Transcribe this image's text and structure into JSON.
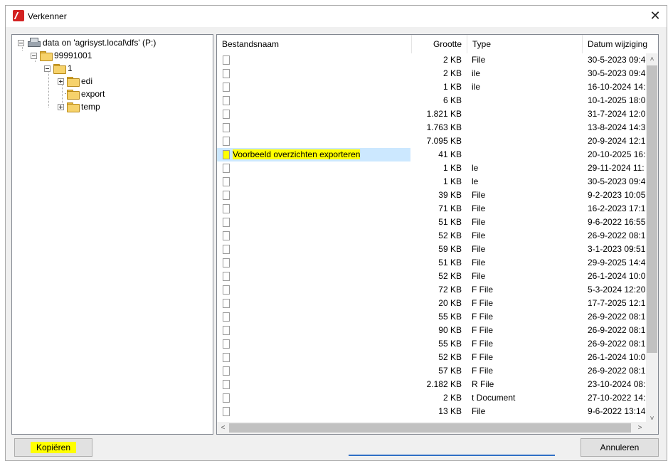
{
  "window": {
    "title": "Verkenner",
    "close_glyph": "✕"
  },
  "tree": {
    "drive_label": "data on 'agrisyst.local\\dfs' (P:)",
    "nodes": [
      {
        "label": "99991001"
      },
      {
        "label": "1"
      },
      {
        "label": "edi"
      },
      {
        "label": "export"
      },
      {
        "label": "temp"
      }
    ]
  },
  "list": {
    "columns": {
      "name": "Bestandsnaam",
      "size": "Grootte",
      "type": "Type",
      "date": "Datum wijziging"
    },
    "rows": [
      {
        "name": "",
        "size": "2 KB",
        "type": "File",
        "date": "30-5-2023 09:4"
      },
      {
        "name": "",
        "size": "2 KB",
        "type": "ile",
        "date": "30-5-2023 09:4"
      },
      {
        "name": "",
        "size": "1 KB",
        "type": "ile",
        "date": "16-10-2024 14:"
      },
      {
        "name": "",
        "size": "6 KB",
        "type": "",
        "date": "10-1-2025 18:0"
      },
      {
        "name": "",
        "size": "1.821 KB",
        "type": "",
        "date": "31-7-2024 12:0"
      },
      {
        "name": "",
        "size": "1.763 KB",
        "type": "",
        "date": "13-8-2024 14:3"
      },
      {
        "name": "",
        "size": "7.095 KB",
        "type": "",
        "date": "20-9-2024 12:1"
      },
      {
        "name": "Voorbeeld overzichten exporteren",
        "size": "41 KB",
        "type": "",
        "date": "20-10-2025 16:",
        "selected": true
      },
      {
        "name": "",
        "size": "1 KB",
        "type": "le",
        "date": "29-11-2024 11:"
      },
      {
        "name": "",
        "size": "1 KB",
        "type": "le",
        "date": "30-5-2023 09:4"
      },
      {
        "name": "",
        "size": "39 KB",
        "type": "File",
        "date": "9-2-2023 10:05"
      },
      {
        "name": "",
        "size": "71 KB",
        "type": "File",
        "date": "16-2-2023 17:1"
      },
      {
        "name": "",
        "size": "51 KB",
        "type": "File",
        "date": "9-6-2022 16:55"
      },
      {
        "name": "",
        "size": "52 KB",
        "type": "File",
        "date": "26-9-2022 08:1"
      },
      {
        "name": "",
        "size": "59 KB",
        "type": "File",
        "date": "3-1-2023 09:51"
      },
      {
        "name": "",
        "size": "51 KB",
        "type": "File",
        "date": "29-9-2025 14:4"
      },
      {
        "name": "",
        "size": "52 KB",
        "type": "File",
        "date": "26-1-2024 10:0"
      },
      {
        "name": "",
        "size": "72 KB",
        "type": "F File",
        "date": "5-3-2024 12:20"
      },
      {
        "name": "",
        "size": "20 KB",
        "type": "F File",
        "date": "17-7-2025 12:1"
      },
      {
        "name": "",
        "size": "55 KB",
        "type": "F File",
        "date": "26-9-2022 08:1"
      },
      {
        "name": "",
        "size": "90 KB",
        "type": "F File",
        "date": "26-9-2022 08:1"
      },
      {
        "name": "",
        "size": "55 KB",
        "type": "F File",
        "date": "26-9-2022 08:1"
      },
      {
        "name": "",
        "size": "52 KB",
        "type": "F File",
        "date": "26-1-2024 10:0"
      },
      {
        "name": "",
        "size": "57 KB",
        "type": "F File",
        "date": "26-9-2022 08:1"
      },
      {
        "name": "",
        "size": "2.182 KB",
        "type": "R File",
        "date": "23-10-2024 08:"
      },
      {
        "name": "",
        "size": "2 KB",
        "type": "t Document",
        "date": "27-10-2022 14:"
      },
      {
        "name": "",
        "size": "13 KB",
        "type": "File",
        "date": "9-6-2022 13:14"
      }
    ]
  },
  "scroll": {
    "up": "˄",
    "down": "˅",
    "left": "<",
    "right": ">"
  },
  "buttons": {
    "copy_label": "Kopiëren",
    "cancel_label": "Annuleren"
  },
  "colors": {
    "highlight": "#ffff00",
    "selection": "#cce8ff",
    "app_icon": "#d32222"
  }
}
